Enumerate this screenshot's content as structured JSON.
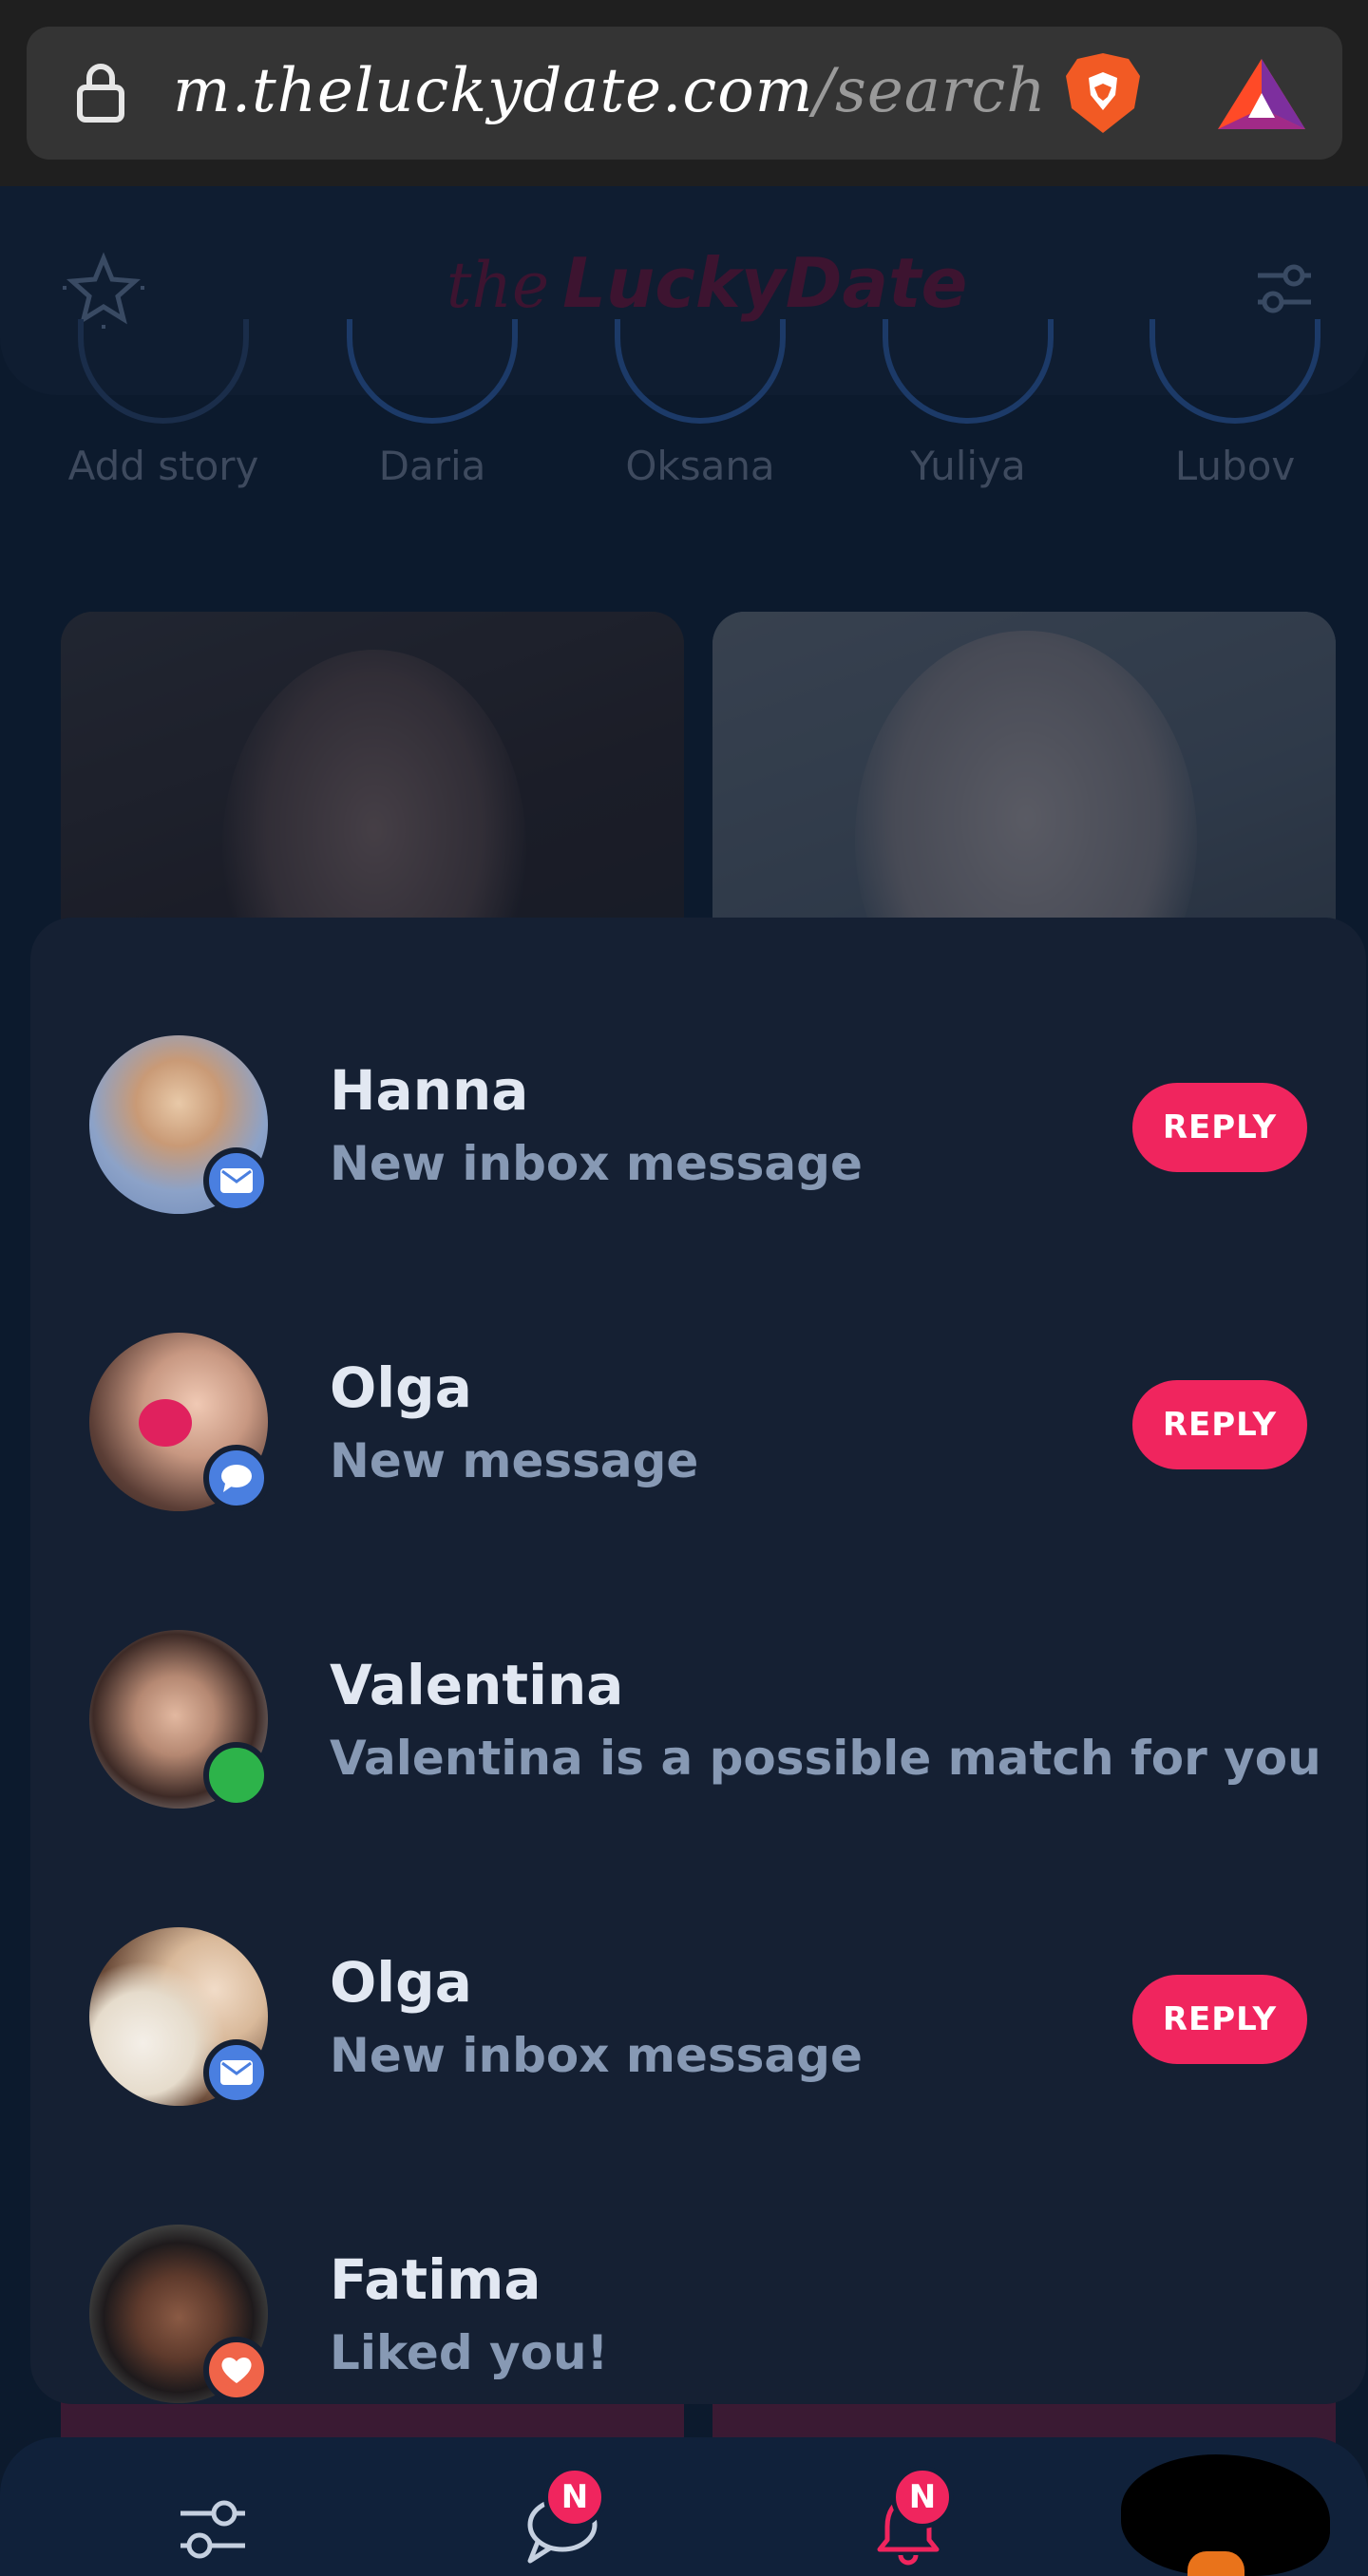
{
  "browser": {
    "url_host": "m.theluckydate.com",
    "url_path": "/search"
  },
  "header": {
    "logo_script": "the",
    "logo_brand": "LuckyDate"
  },
  "stories": [
    {
      "name": "Add story"
    },
    {
      "name": "Daria"
    },
    {
      "name": "Oksana"
    },
    {
      "name": "Yuliya"
    },
    {
      "name": "Lubov"
    }
  ],
  "notifications": [
    {
      "name": "Hanna",
      "text": "New inbox message",
      "badge": "mail-icon",
      "badge_color": "#4a7fe0",
      "reply": "REPLY"
    },
    {
      "name": "Olga",
      "text": "New message",
      "badge": "chat-icon",
      "badge_color": "#4a7fe0",
      "reply": "REPLY"
    },
    {
      "name": "Valentina",
      "text": "Valentina is a possible match for you",
      "badge": "online-dot",
      "badge_color": "#2db34a"
    },
    {
      "name": "Olga",
      "text": "New inbox message",
      "badge": "mail-icon",
      "badge_color": "#4a7fe0",
      "reply": "REPLY"
    },
    {
      "name": "Fatima",
      "text": "Liked you!",
      "badge": "heart-icon",
      "badge_color": "#f06449"
    }
  ],
  "bottom_nav": {
    "messages_badge": "N",
    "notifications_badge": "N"
  },
  "colors": {
    "accent": "#f0255e",
    "panel": "#152033",
    "background": "#0c1a2d"
  }
}
